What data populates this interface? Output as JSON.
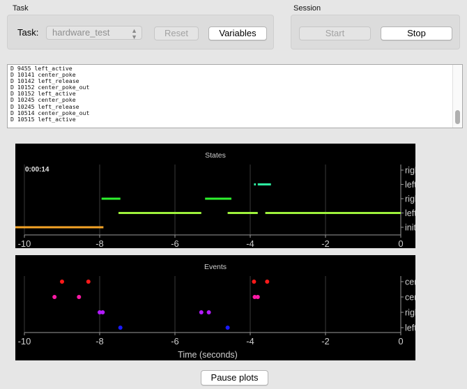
{
  "task_group": {
    "title": "Task",
    "task_label": "Task:",
    "task_value": "hardware_test",
    "reset_label": "Reset",
    "variables_label": "Variables"
  },
  "session_group": {
    "title": "Session",
    "start_label": "Start",
    "stop_label": "Stop"
  },
  "log_lines": [
    "D 9455 left_active",
    "D 10141 center_poke",
    "D 10142 left_release",
    "D 10152 center_poke_out",
    "D 10152 left_active",
    "D 10245 center_poke",
    "D 10245 left_release",
    "D 10514 center_poke_out",
    "D 10515 left_active"
  ],
  "pause_label": "Pause plots",
  "colors": {
    "orange": "#f4a326",
    "green": "#2ef22e",
    "lime": "#9ef23c",
    "teal": "#2ef2a2",
    "red": "#ff1a1a",
    "magenta": "#ff1aa6",
    "purple": "#b31aff",
    "blue": "#1a1aff"
  },
  "chart_data": [
    {
      "type": "timeline",
      "title": "States",
      "elapsed_label": "0:00:14",
      "xlabel": "",
      "xlim": [
        -10,
        0
      ],
      "xticks": [
        -10,
        -8,
        -6,
        -4,
        -2,
        0
      ],
      "categories": [
        "init_state",
        "left_active",
        "right_active",
        "left_release",
        "right_release"
      ],
      "segments": [
        {
          "state": "init_state",
          "start": -10.3,
          "end": -7.9,
          "color": "#f4a326"
        },
        {
          "state": "right_active",
          "start": -7.95,
          "end": -7.45,
          "color": "#2ef22e"
        },
        {
          "state": "left_active",
          "start": -7.5,
          "end": -5.3,
          "color": "#9ef23c"
        },
        {
          "state": "right_active",
          "start": -5.2,
          "end": -4.5,
          "color": "#2ef22e"
        },
        {
          "state": "left_active",
          "start": -4.6,
          "end": -3.8,
          "color": "#9ef23c"
        },
        {
          "state": "left_release",
          "start": -3.9,
          "end": -3.85,
          "color": "#2ef2a2"
        },
        {
          "state": "left_release",
          "start": -3.8,
          "end": -3.45,
          "color": "#2ef2a2"
        },
        {
          "state": "left_active",
          "start": -3.6,
          "end": 0.3,
          "color": "#9ef23c"
        }
      ]
    },
    {
      "type": "scatter",
      "title": "Events",
      "xlabel": "Time (seconds)",
      "xlim": [
        -10,
        0
      ],
      "xticks": [
        -10,
        -8,
        -6,
        -4,
        -2,
        0
      ],
      "categories": [
        "left_poke",
        "right_poke",
        "center_poke",
        "center_poke"
      ],
      "series": [
        {
          "row": 3,
          "color": "#ff1a1a",
          "x": [
            -9.0,
            -8.3,
            -3.9,
            -3.55
          ]
        },
        {
          "row": 2,
          "color": "#ff1aa6",
          "x": [
            -9.2,
            -8.55,
            -3.88,
            -3.8
          ]
        },
        {
          "row": 1,
          "color": "#b31aff",
          "x": [
            -8.0,
            -7.92,
            -5.3,
            -5.1
          ]
        },
        {
          "row": 0,
          "color": "#1a1aff",
          "x": [
            -7.45,
            -4.6
          ]
        }
      ]
    }
  ]
}
